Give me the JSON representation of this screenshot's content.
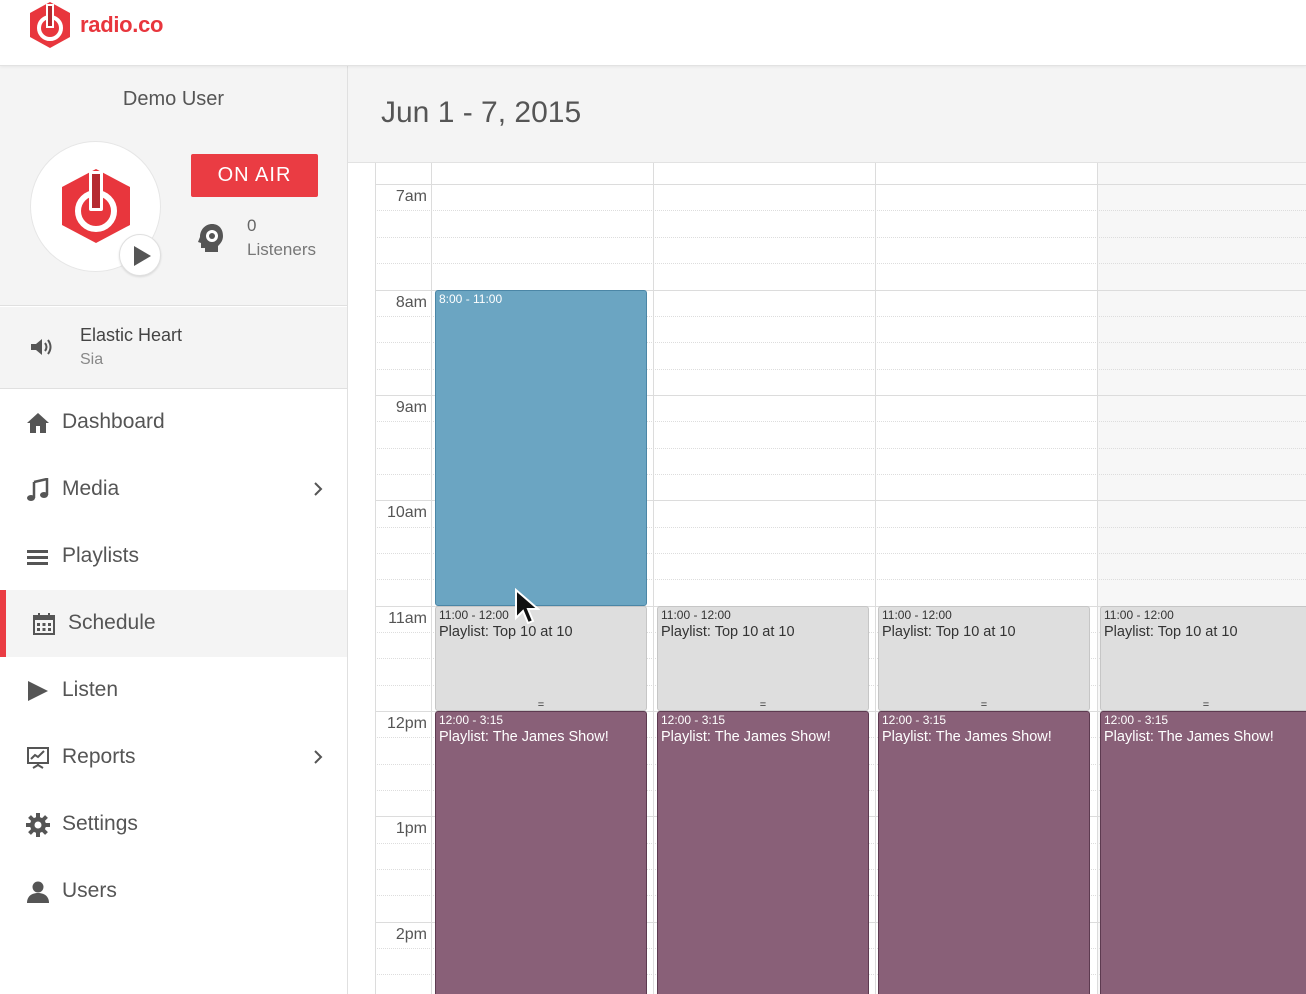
{
  "brand": {
    "name": "radio.co",
    "color": "#e8363d"
  },
  "profile": {
    "user_name": "Demo User",
    "status_button": "ON AIR",
    "listeners_count": "0",
    "listeners_label": "Listeners",
    "play_icon": "play-icon"
  },
  "now_playing": {
    "title": "Elastic Heart",
    "artist": "Sia",
    "icon": "speaker-icon"
  },
  "nav": {
    "items": [
      {
        "label": "Dashboard",
        "icon": "home-icon"
      },
      {
        "label": "Media",
        "icon": "music-note-icon",
        "has_submenu": true
      },
      {
        "label": "Playlists",
        "icon": "list-icon"
      },
      {
        "label": "Schedule",
        "icon": "calendar-icon",
        "active": true
      },
      {
        "label": "Listen",
        "icon": "play-icon"
      },
      {
        "label": "Reports",
        "icon": "presentation-chart-icon",
        "has_submenu": true
      },
      {
        "label": "Settings",
        "icon": "gear-icon"
      },
      {
        "label": "Users",
        "icon": "user-icon"
      }
    ]
  },
  "schedule": {
    "date_range": "Jun 1 - 7, 2015",
    "time_labels": [
      "7am",
      "8am",
      "9am",
      "10am",
      "11am",
      "12pm",
      "1pm",
      "2pm"
    ],
    "events": {
      "blue": {
        "time": "8:00 - 11:00",
        "title": ""
      },
      "top10": {
        "time": "11:00 - 12:00",
        "title": "Playlist: Top 10 at 10",
        "handle": "="
      },
      "james": {
        "time": "12:00 - 3:15",
        "title": "Playlist: The James Show!"
      }
    },
    "colors": {
      "blue": "#6ba5c2",
      "gray": "#dedede",
      "purple": "#896078",
      "accent": "#ea3c43"
    }
  }
}
